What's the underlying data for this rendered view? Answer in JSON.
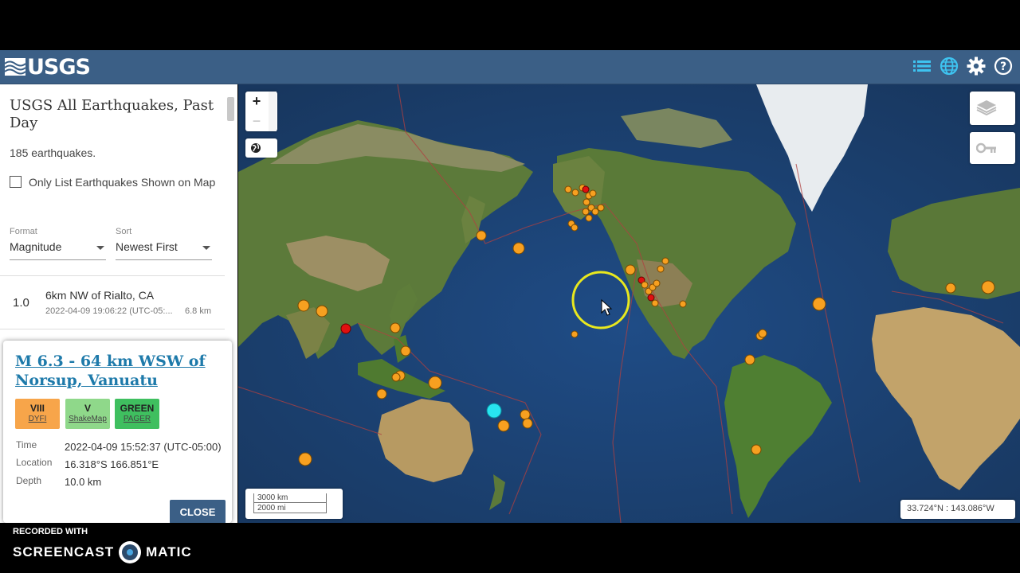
{
  "header": {
    "logo_text": "USGS",
    "icons": [
      "list-icon",
      "globe-icon",
      "gear-icon",
      "help-icon"
    ]
  },
  "sidebar": {
    "title": "USGS All Earthquakes, Past Day",
    "count": "185 earthquakes.",
    "checkbox_label": "Only List Earthquakes Shown on Map",
    "format_label": "Format",
    "format_value": "Magnitude",
    "sort_label": "Sort",
    "sort_value": "Newest First",
    "list": [
      {
        "mag": "1.0",
        "place": "6km NW of Rialto, CA",
        "time": "2022-04-09 19:06:22 (UTC-05:...",
        "depth": "6.8 km"
      }
    ]
  },
  "popup": {
    "title": "M 6.3 - 64 km WSW of Norsup, Vanuatu",
    "badges": [
      {
        "value": "VIII",
        "label": "DYFI",
        "color": "#f7a54a"
      },
      {
        "value": "V",
        "label": "ShakeMap",
        "color": "#8fd88a"
      },
      {
        "value": "GREEN",
        "label": "PAGER",
        "color": "#3fbf5f"
      }
    ],
    "time_label": "Time",
    "time_value": "2022-04-09 15:52:37 (UTC-05:00)",
    "location_label": "Location",
    "location_value": "16.318°S 166.851°E",
    "depth_label": "Depth",
    "depth_value": "10.0 km",
    "close_label": "CLOSE"
  },
  "map": {
    "zoom_in": "+",
    "zoom_out": "−",
    "scale_km": "3000 km",
    "scale_mi": "2000 mi",
    "coords": "33.724°N : 143.086°W",
    "colors": {
      "ocean": "#1b3d70",
      "land": "#5f7d3c",
      "quake_orange": "#f7a020",
      "quake_red": "#e01010",
      "quake_cyan": "#28e4f0",
      "cursor_ring": "#e8e81e"
    }
  },
  "recorder": {
    "line1": "RECORDED WITH",
    "line2a": "SCREENCAST",
    "line2b": "MATIC"
  }
}
